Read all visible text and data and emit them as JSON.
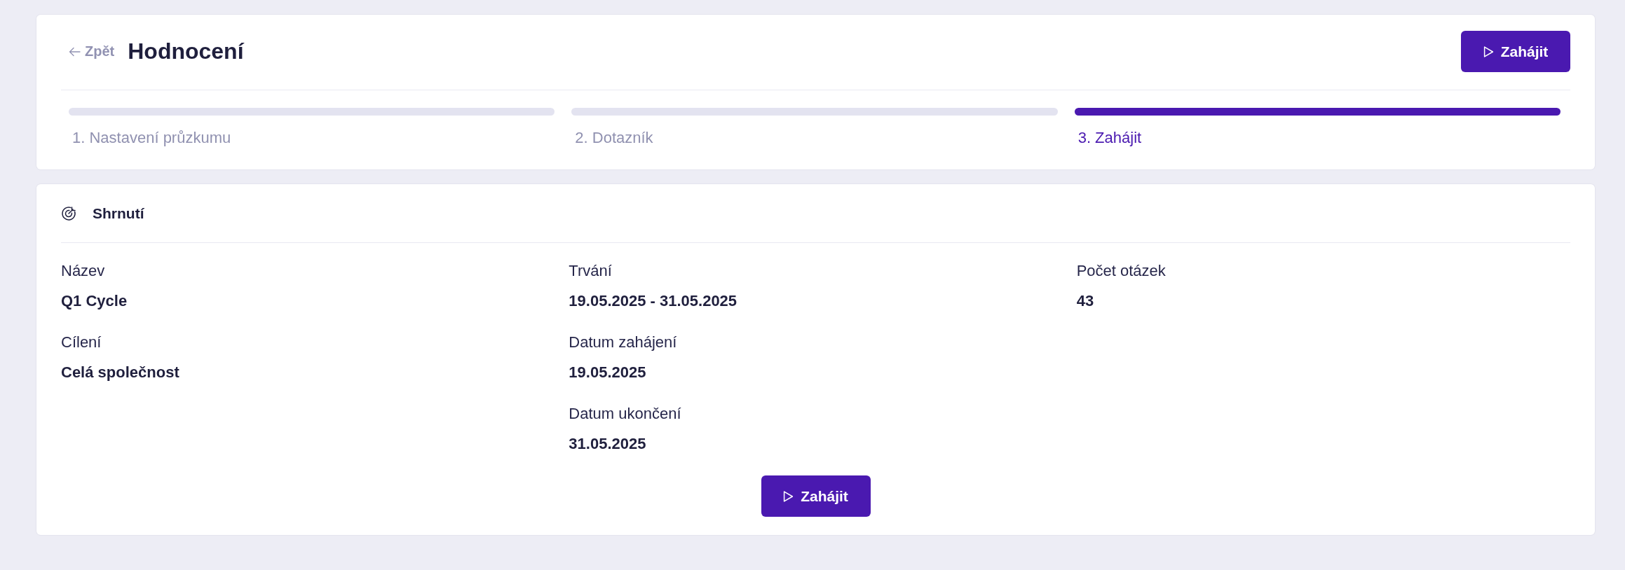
{
  "header": {
    "back_link": "Zpět",
    "title": "Hodnocení",
    "start_button": "Zahájit"
  },
  "steps": [
    {
      "label": "1. Nastavení průzkumu",
      "selected": false
    },
    {
      "label": "2. Dotazník",
      "selected": false
    },
    {
      "label": "3. Zahájit",
      "selected": true
    }
  ],
  "summary": {
    "title": "Shrnutí",
    "columns": [
      [
        {
          "label": "Název",
          "value": "Q1 Cycle"
        },
        {
          "label": "Cílení",
          "value": "Celá společnost"
        }
      ],
      [
        {
          "label": "Trvání",
          "value": "19.05.2025 - 31.05.2025"
        },
        {
          "label": "Datum zahájení",
          "value": "19.05.2025"
        },
        {
          "label": "Datum ukončení",
          "value": "31.05.2025"
        }
      ],
      [
        {
          "label": "Počet otázek",
          "value": "43"
        }
      ]
    ],
    "start_button": "Zahájit"
  }
}
